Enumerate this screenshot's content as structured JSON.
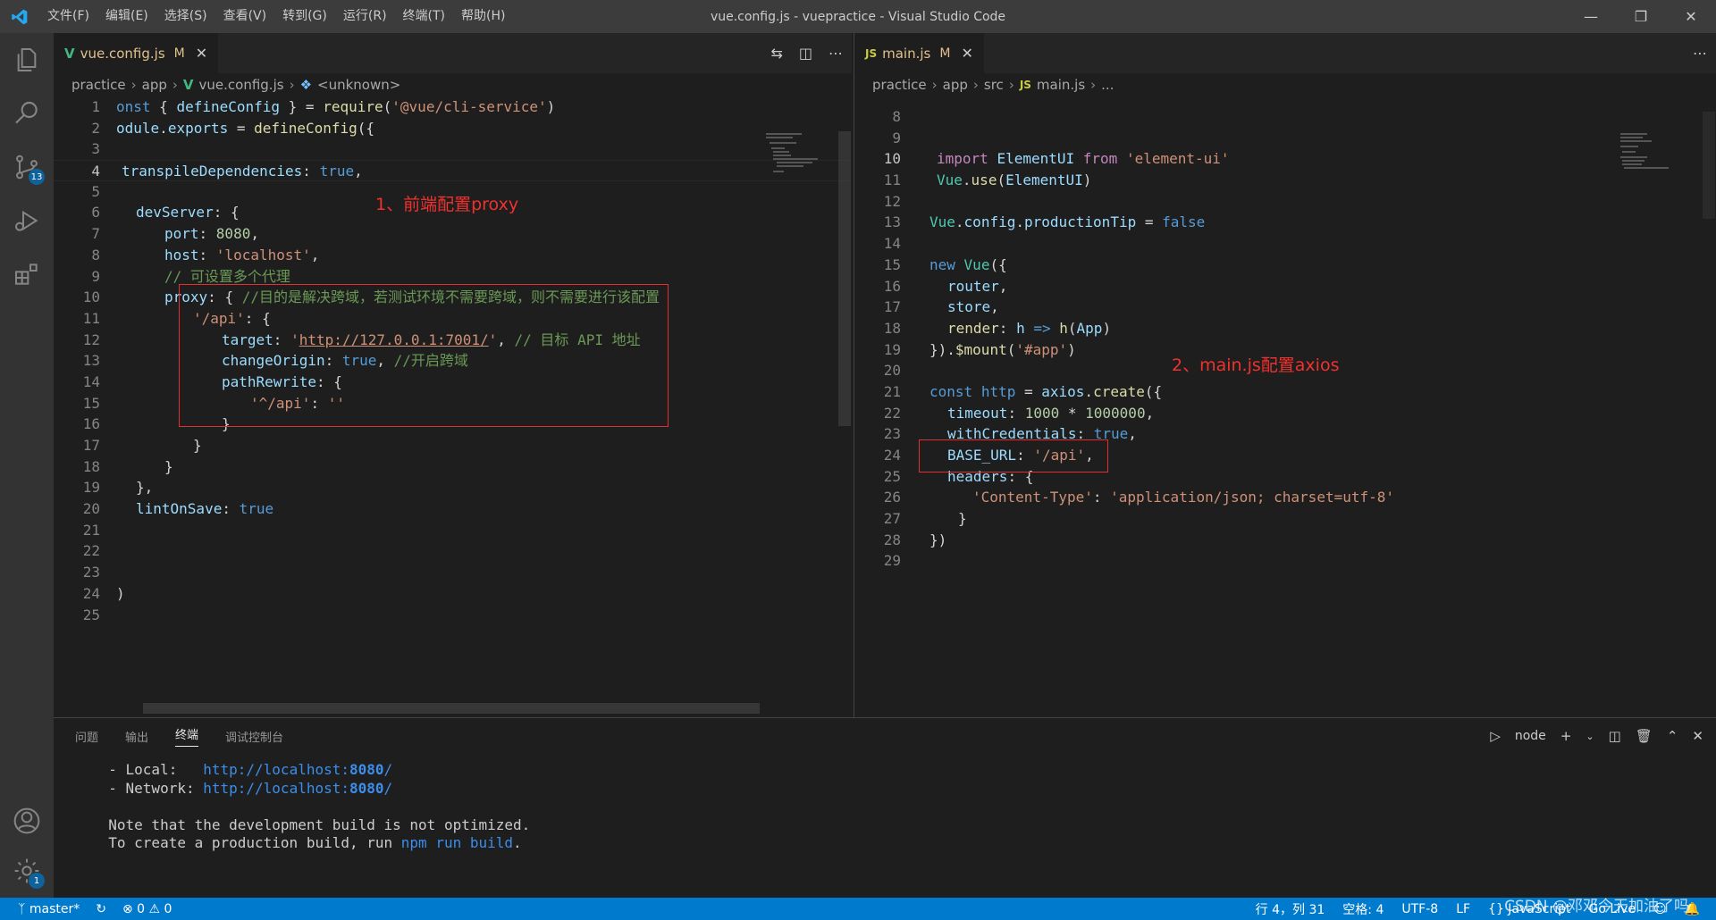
{
  "window": {
    "title": "vue.config.js - vuepractice - Visual Studio Code",
    "menu": [
      "文件(F)",
      "编辑(E)",
      "选择(S)",
      "查看(V)",
      "转到(G)",
      "运行(R)",
      "终端(T)",
      "帮助(H)"
    ]
  },
  "activity_bar": {
    "icons": [
      "explorer-icon",
      "search-icon",
      "source-control-icon",
      "run-debug-icon",
      "extensions-icon",
      "account-icon",
      "manage-gear-icon"
    ],
    "source_control_badge": "13",
    "gear_badge": "1"
  },
  "left_editor": {
    "tab": {
      "label": "vue.config.js",
      "modified": "M"
    },
    "breadcrumb": [
      "practice",
      "app",
      "vue.config.js",
      "<unknown>"
    ],
    "lines": [
      "1",
      "2",
      "3",
      "4",
      "5",
      "6",
      "7",
      "8",
      "9",
      "10",
      "11",
      "12",
      "13",
      "14",
      "15",
      "16",
      "17",
      "18",
      "19",
      "20",
      "21",
      "22",
      "23",
      "24",
      "25"
    ],
    "annotation": "1、前端配置proxy"
  },
  "right_editor": {
    "tab": {
      "label": "main.js",
      "modified": "M"
    },
    "breadcrumb": [
      "practice",
      "app",
      "src",
      "main.js",
      "..."
    ],
    "annotation": "2、main.js配置axios"
  },
  "panel": {
    "tabs": [
      "问题",
      "输出",
      "终端",
      "调试控制台"
    ],
    "active_tab": "终端",
    "terminal_name": "node",
    "terminal": {
      "local_label": "  - Local:   ",
      "local_url_pre": "http://localhost:",
      "local_port": "8080",
      "local_slash": "/",
      "network_label": "  - Network: ",
      "network_url_pre": "http://localhost:",
      "network_port": "8080",
      "network_slash": "/",
      "note1": "  Note that the development build is not optimized.",
      "note2_pre": "  To create a production build, run ",
      "note2_cmd": "npm run build",
      "note2_post": "."
    }
  },
  "status_bar": {
    "branch": "master*",
    "errors": "0",
    "warnings": "0",
    "position": "行 4，列 31",
    "spaces": "空格: 4",
    "encoding": "UTF-8",
    "eol": "LF",
    "language": "{} JavaScript",
    "golive": "Go Live"
  },
  "watermark": "CSDN @邓邓今天加油了吗",
  "colors": {
    "accent": "#007acc",
    "annotation_red": "#e03030"
  }
}
